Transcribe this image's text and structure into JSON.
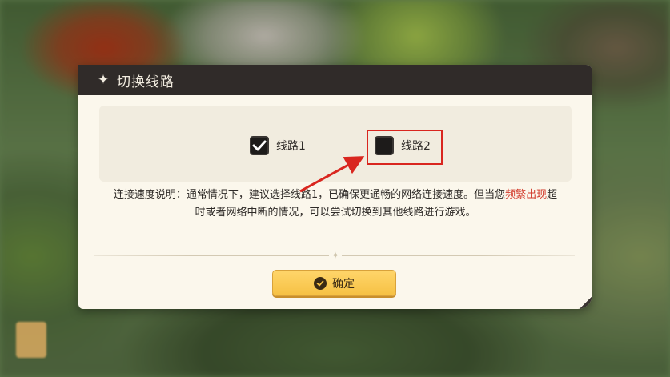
{
  "dialog": {
    "title": "切换线路",
    "title_icon": "sparkle-icon",
    "options": [
      {
        "label": "线路1",
        "checked": true
      },
      {
        "label": "线路2",
        "checked": false
      }
    ],
    "description_part1": "连接速度说明：通常情况下，建议选择线路1，已确保更通畅的网络连接速度。但当您",
    "description_highlight": "频繁出现",
    "description_part2": "超时或者网络中断的情况，可以尝试切换到其他线路进行游戏。",
    "confirm_label": "确定",
    "confirm_icon": "check-circle-icon"
  },
  "colors": {
    "header_bg": "#302b29",
    "dialog_bg": "#fbf7ec",
    "accent_button": "#f6c144",
    "highlight_text": "#d23a2a",
    "annotation_red": "#d9261f"
  }
}
